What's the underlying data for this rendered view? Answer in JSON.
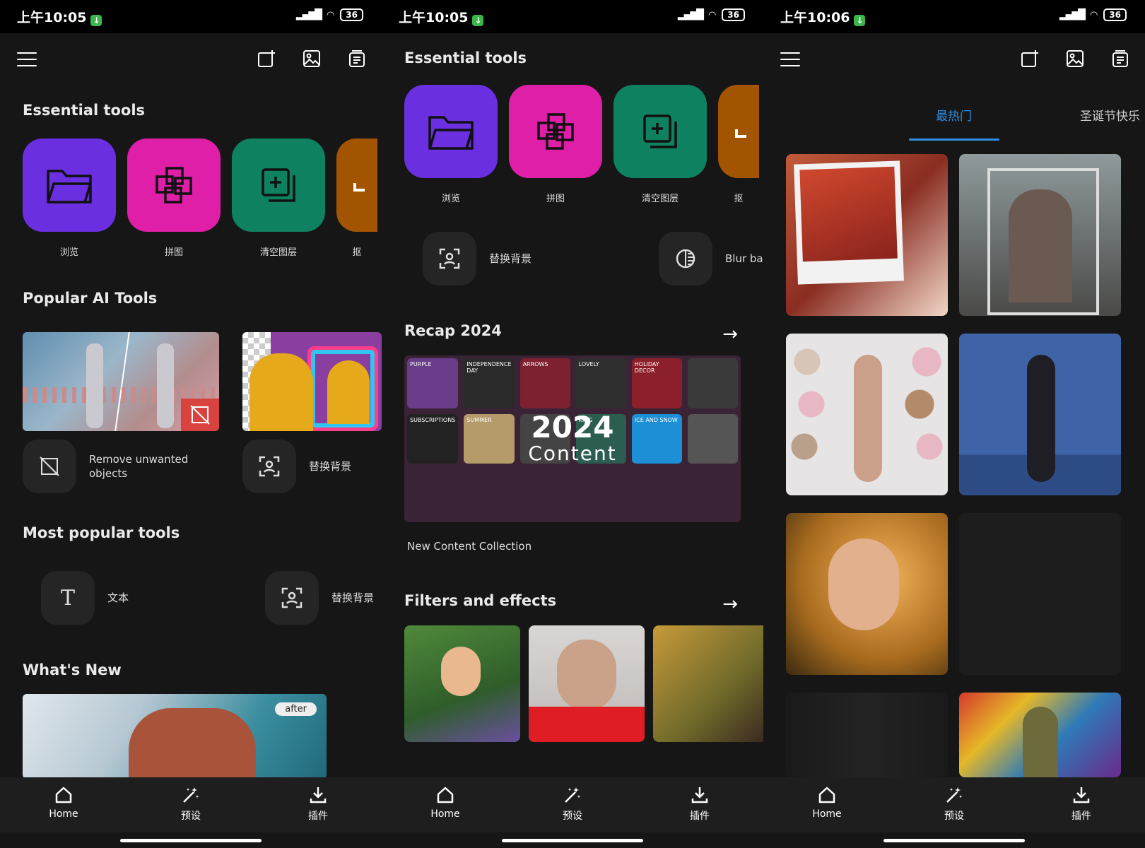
{
  "status": {
    "s1_time": "上午10:05",
    "s2_time": "上午10:05",
    "s3_time": "上午10:06",
    "battery": "36"
  },
  "screen1": {
    "essential_title": "Essential tools",
    "tools": [
      {
        "label": "浏览",
        "color": "#6a2fe0"
      },
      {
        "label": "拼图",
        "color": "#e01fa8"
      },
      {
        "label": "清空图层",
        "color": "#0d8160"
      },
      {
        "label": "抠",
        "color": "#a35400"
      }
    ],
    "ai_title": "Popular AI Tools",
    "ai_tools": [
      {
        "label": "Remove unwanted objects"
      },
      {
        "label": "替换背景"
      }
    ],
    "most_popular_title": "Most popular tools",
    "most_popular": [
      {
        "label": "文本"
      },
      {
        "label": "替换背景"
      }
    ],
    "whats_new_title": "What's New",
    "after_badge": "after"
  },
  "screen2": {
    "essential_title": "Essential tools",
    "tools": [
      {
        "label": "浏览"
      },
      {
        "label": "拼图"
      },
      {
        "label": "清空图层"
      },
      {
        "label": "抠"
      }
    ],
    "quick_tools": [
      {
        "label": "替换背景"
      },
      {
        "label": "Blur ba"
      }
    ],
    "recap_title": "Recap 2024",
    "recap_big": "2024",
    "recap_sub": "Content",
    "recap_caption": "New Content Collection",
    "recap_tags": [
      "PURPLE",
      "INDEPENDENCE DAY",
      "ARROWS",
      "LOVELY",
      "HOLIDAY DECOR",
      "SUBSCRIPTIONS",
      "SUMMER",
      "KING",
      "ICE AND SNOW"
    ],
    "filters_title": "Filters and effects"
  },
  "screen3": {
    "tabs": [
      {
        "label": "最热门",
        "active": true
      },
      {
        "label": "圣诞节快乐",
        "active": false
      }
    ]
  },
  "nav": [
    {
      "label": "Home",
      "icon": "home-icon"
    },
    {
      "label": "预设",
      "icon": "magic-wand-icon"
    },
    {
      "label": "插件",
      "icon": "download-icon"
    }
  ]
}
